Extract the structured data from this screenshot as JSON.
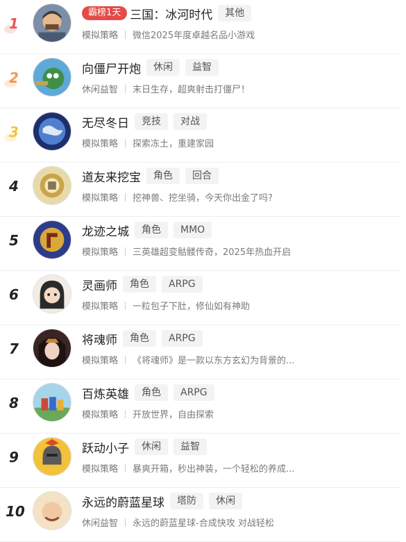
{
  "games": [
    {
      "rank": "1",
      "badge": "霸榜1天",
      "name": "三国：冰河时代",
      "tags": [
        "其他"
      ],
      "category": "模拟策略",
      "desc": "微信2025年度卓越名品小游戏",
      "color": "#5b6f8a"
    },
    {
      "rank": "2",
      "name": "向僵尸开炮",
      "tags": [
        "休闲",
        "益智"
      ],
      "category": "休闲益智",
      "desc": "末日生存，超爽射击打僵尸！",
      "color": "#3f8bc4"
    },
    {
      "rank": "3",
      "name": "无尽冬日",
      "tags": [
        "竞技",
        "对战"
      ],
      "category": "模拟策略",
      "desc": "探索冻土，重建家园",
      "color": "#3a63b6"
    },
    {
      "rank": "4",
      "name": "道友来挖宝",
      "tags": [
        "角色",
        "回合"
      ],
      "category": "模拟策略",
      "desc": "挖神兽、挖坐骑，今天你出金了吗?",
      "color": "#c9a44a"
    },
    {
      "rank": "5",
      "name": "龙迹之城",
      "tags": [
        "角色",
        "MMO"
      ],
      "category": "模拟策略",
      "desc": "三英雄超变骷髅传奇，2025年热血开启",
      "color": "#2d3c8a"
    },
    {
      "rank": "6",
      "name": "灵画师",
      "tags": [
        "角色",
        "ARPG"
      ],
      "category": "模拟策略",
      "desc": "一粒包子下肚，修仙如有神助",
      "color": "#4a4a4a"
    },
    {
      "rank": "7",
      "name": "将魂师",
      "tags": [
        "角色",
        "ARPG"
      ],
      "category": "模拟策略",
      "desc": "《将魂师》是一款以东方玄幻为背景的...",
      "color": "#5a3a3a"
    },
    {
      "rank": "8",
      "name": "百炼英雄",
      "tags": [
        "角色",
        "ARPG"
      ],
      "category": "模拟策略",
      "desc": "开放世界，自由探索",
      "color": "#6aa85a"
    },
    {
      "rank": "9",
      "name": "跃动小子",
      "tags": [
        "休闲",
        "益智"
      ],
      "category": "模拟策略",
      "desc": "暴爽开箱，秒出神装，一个轻松的养成...",
      "color": "#e9b132"
    },
    {
      "rank": "10",
      "name": "永远的蔚蓝星球",
      "tags": [
        "塔防",
        "休闲"
      ],
      "category": "休闲益智",
      "desc": "永远的蔚蓝星球-合成快攻 对战轻松",
      "color": "#e0b070"
    }
  ]
}
